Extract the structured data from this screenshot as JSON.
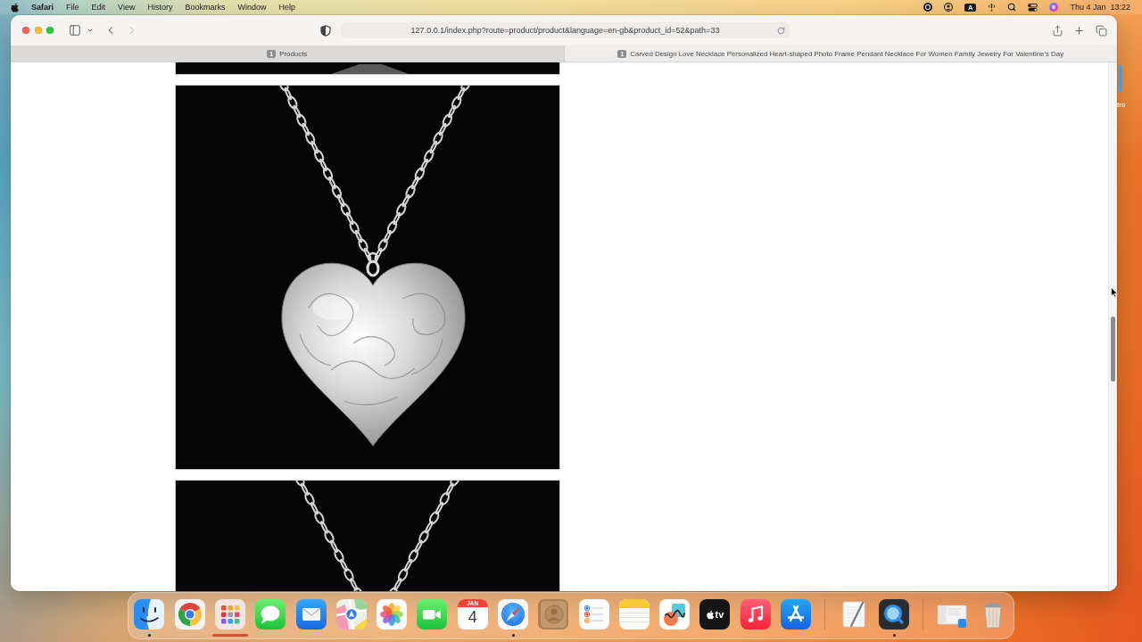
{
  "menu_bar": {
    "app_name": "Safari",
    "menus": [
      "File",
      "Edit",
      "View",
      "History",
      "Bookmarks",
      "Window",
      "Help"
    ],
    "input_source": "A",
    "date": "Thu 4 Jan",
    "time": "13:22"
  },
  "desktop_icons": [
    {
      "label": "tro"
    }
  ],
  "toolbar": {
    "nav_buttons": [
      {
        "kind": "back",
        "disabled": false
      },
      {
        "kind": "forward",
        "disabled": true
      }
    ],
    "address": "127.0.0.1/index.php?route=product/product&language=en-gb&product_id=52&path=33"
  },
  "tabs": [
    {
      "favicon": "1",
      "title": "Products",
      "selected": false
    },
    {
      "favicon": "1",
      "title": "Carved Design Love Necklace Personalized Heart-shaped Photo Frame Pendant Necklace For Women Family Jewelry For Valentine's Day",
      "selected": true
    }
  ],
  "page": {
    "images": [
      {
        "kind": "edge"
      },
      {
        "kind": "heart_pendant"
      },
      {
        "kind": "chain"
      }
    ]
  },
  "dock": {
    "sections": [
      {
        "items": [
          {
            "kind": "finder",
            "running": true,
            "underlined": false
          },
          {
            "kind": "chrome",
            "running": false,
            "underlined": false
          },
          {
            "kind": "launchpad",
            "running": false,
            "underlined": true
          },
          {
            "kind": "messages",
            "running": false,
            "underlined": false
          },
          {
            "kind": "mail",
            "running": false,
            "underlined": false
          },
          {
            "kind": "maps",
            "running": false,
            "underlined": false
          },
          {
            "kind": "photos",
            "running": false,
            "underlined": false
          },
          {
            "kind": "facetime",
            "running": false,
            "underlined": false
          },
          {
            "kind": "calendar",
            "month": "JAN",
            "day": "4",
            "running": false,
            "underlined": false
          },
          {
            "kind": "safari",
            "running": true,
            "underlined": false
          },
          {
            "kind": "contacts",
            "running": false,
            "underlined": false
          },
          {
            "kind": "reminders",
            "running": false,
            "underlined": false
          },
          {
            "kind": "notes",
            "running": false,
            "underlined": false
          },
          {
            "kind": "freeform",
            "running": false,
            "underlined": false
          },
          {
            "kind": "tv",
            "label": "tv",
            "running": false,
            "underlined": false
          },
          {
            "kind": "music",
            "running": false,
            "underlined": false
          },
          {
            "kind": "appstore",
            "running": false,
            "underlined": false
          }
        ]
      },
      {
        "items": [
          {
            "kind": "textedit",
            "running": false,
            "underlined": false
          },
          {
            "kind": "quicktime",
            "running": true,
            "underlined": false
          }
        ]
      },
      {
        "items": [
          {
            "kind": "stack",
            "running": false,
            "underlined": false
          },
          {
            "kind": "trash",
            "running": false,
            "underlined": false
          }
        ]
      }
    ]
  }
}
